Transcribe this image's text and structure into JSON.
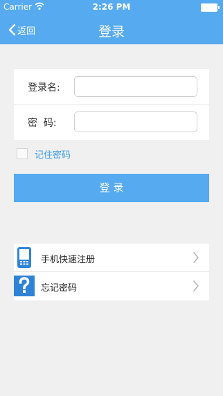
{
  "status_bar": {
    "carrier": "Carrier",
    "time": "2:26 PM"
  },
  "nav": {
    "back_label": "返回",
    "title": "登录"
  },
  "form": {
    "username_label": "登录名:",
    "username_value": "",
    "password_label": "密  码:",
    "password_value": ""
  },
  "remember": {
    "label": "记住密码",
    "checked": false
  },
  "login_button": {
    "label": "登 录"
  },
  "menu": {
    "items": [
      {
        "label": "手机快速注册",
        "icon": "phone-icon"
      },
      {
        "label": "忘记密码",
        "icon": "question-icon"
      }
    ]
  },
  "colors": {
    "accent": "#55aaf0",
    "link": "#3a9be8"
  }
}
